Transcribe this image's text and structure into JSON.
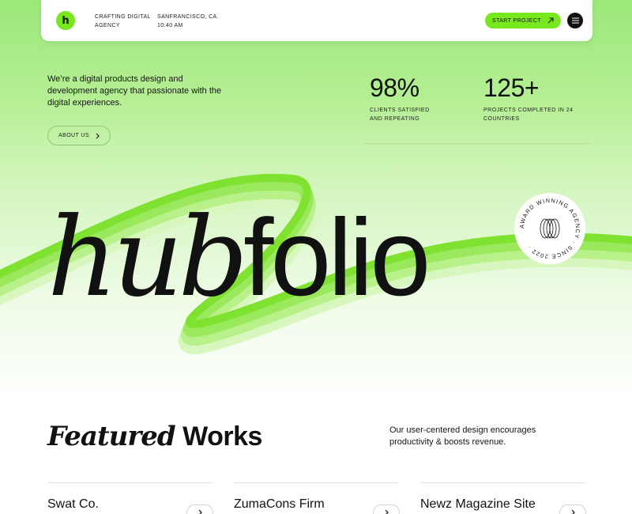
{
  "header": {
    "logo_letter": "h",
    "tagline_line1": "CRAFTING DIGITAL",
    "tagline_line2": "AGENCY",
    "location_city": "SANFRANCISCO, CA.",
    "location_time": "10:40 AM",
    "cta_label": "START PROJECT",
    "cta_icon": "arrow-up-right-icon",
    "menu_icon": "hamburger-icon"
  },
  "hero": {
    "intro_text": "We’re a digital products design and development agency that passionate with the digital experiences.",
    "about_label": "ABOUT US",
    "stats": [
      {
        "value": "98%",
        "label_line1": "CLIENTS SATISFIED",
        "label_line2": "AND REPEATING"
      },
      {
        "value": "125+",
        "label_line1": "PROJECTS COMPLETED IN 24",
        "label_line2": "COUNTRIES"
      }
    ],
    "wordmark_italic": "hub",
    "wordmark_regular": "folio",
    "badge_text": "AWARD WINNING AGENCY · SINCE 2022 ·"
  },
  "featured": {
    "title_italic": "Featured",
    "title_regular": "Works",
    "description": "Our user-centered design encourages productivity & boosts revenue.",
    "cards": [
      {
        "title": "Swat Co."
      },
      {
        "title": "ZumaCons Firm"
      },
      {
        "title": "Newz Magazine Site"
      }
    ]
  },
  "colors": {
    "accent": "#77e81e",
    "dark": "#111111"
  }
}
